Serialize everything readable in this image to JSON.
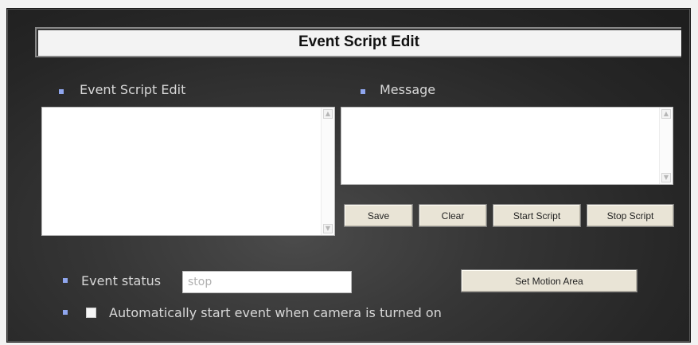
{
  "header": {
    "title": "Event Script Edit"
  },
  "left_panel": {
    "label": "Event Script Edit",
    "script_value": ""
  },
  "right_panel": {
    "label": "Message",
    "message_value": ""
  },
  "buttons": {
    "save": "Save",
    "clear": "Clear",
    "start_script": "Start Script",
    "stop_script": "Stop Script",
    "set_motion_area": "Set Motion Area"
  },
  "event_status": {
    "label": "Event status",
    "value": "stop"
  },
  "auto_start": {
    "label": "Automatically start event when camera is turned on",
    "checked": false
  },
  "icons": {
    "bullet": "square-bullet-icon",
    "scroll_up": "scroll-up-arrow-icon",
    "scroll_down": "scroll-down-arrow-icon"
  },
  "colors": {
    "bullet": "#8fa6ee",
    "button_bg": "#e9e4d6",
    "panel_bg": "#2e2e2e"
  }
}
